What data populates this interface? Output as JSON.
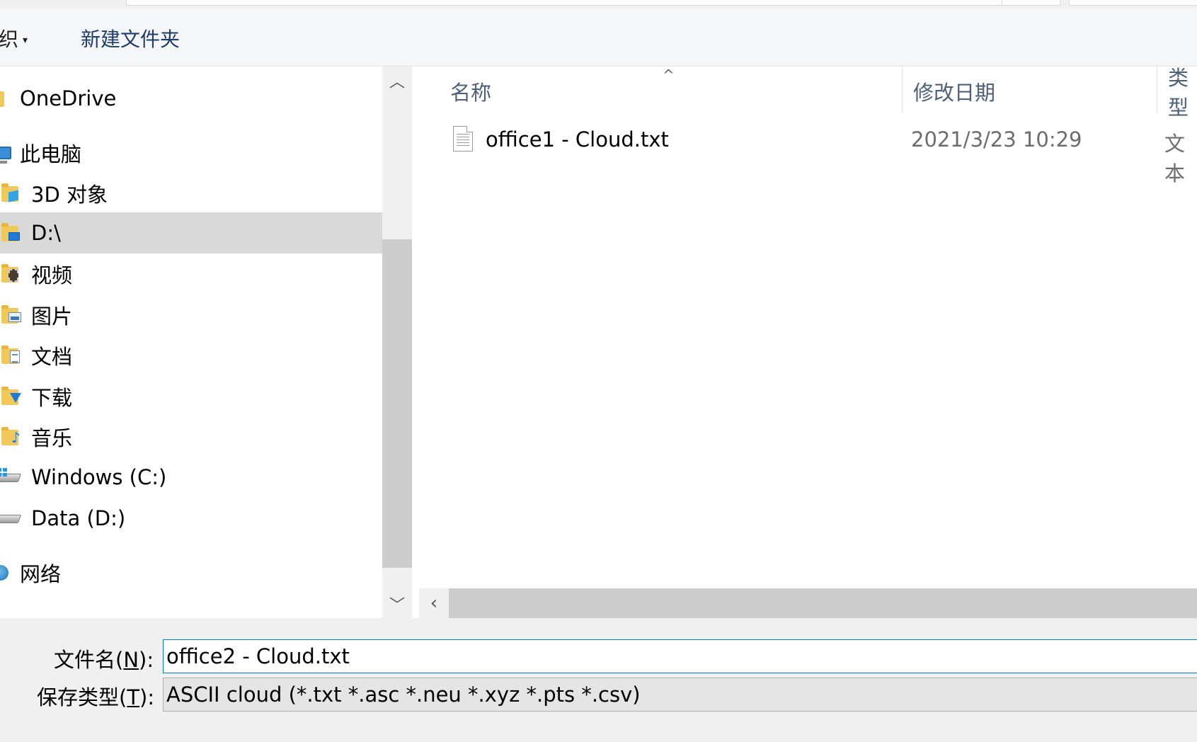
{
  "toolbar": {
    "organize_label": "织",
    "organize_caret": "▾",
    "new_folder_label": "新建文件夹"
  },
  "nav": {
    "items": [
      {
        "label": "OneDrive"
      },
      {
        "label": "此电脑"
      },
      {
        "label": "3D 对象"
      },
      {
        "label": "D:\\"
      },
      {
        "label": "视频"
      },
      {
        "label": "图片"
      },
      {
        "label": "文档"
      },
      {
        "label": "下载"
      },
      {
        "label": "音乐"
      },
      {
        "label": "Windows (C:)"
      },
      {
        "label": "Data (D:)"
      },
      {
        "label": "网络"
      }
    ],
    "selected_index": 3
  },
  "list": {
    "columns": [
      {
        "label": "名称"
      },
      {
        "label": "修改日期"
      },
      {
        "label": "类型"
      }
    ],
    "rows": [
      {
        "name": "office1 - Cloud.txt",
        "modified": "2021/3/23 10:29",
        "type": "文本"
      }
    ]
  },
  "form": {
    "filename_label_prefix": "文件名(",
    "filename_label_key": "N",
    "filename_label_suffix": "):",
    "filename_value": "office2 - Cloud.txt",
    "filetype_label_prefix": "保存类型(",
    "filetype_label_key": "T",
    "filetype_label_suffix": "):",
    "filetype_value": "ASCII cloud (*.txt *.asc *.neu *.xyz *.pts *.csv)"
  },
  "colors": {
    "selection": "#d9d9d9",
    "accent": "#0078d7",
    "header_text": "#4c607a"
  }
}
